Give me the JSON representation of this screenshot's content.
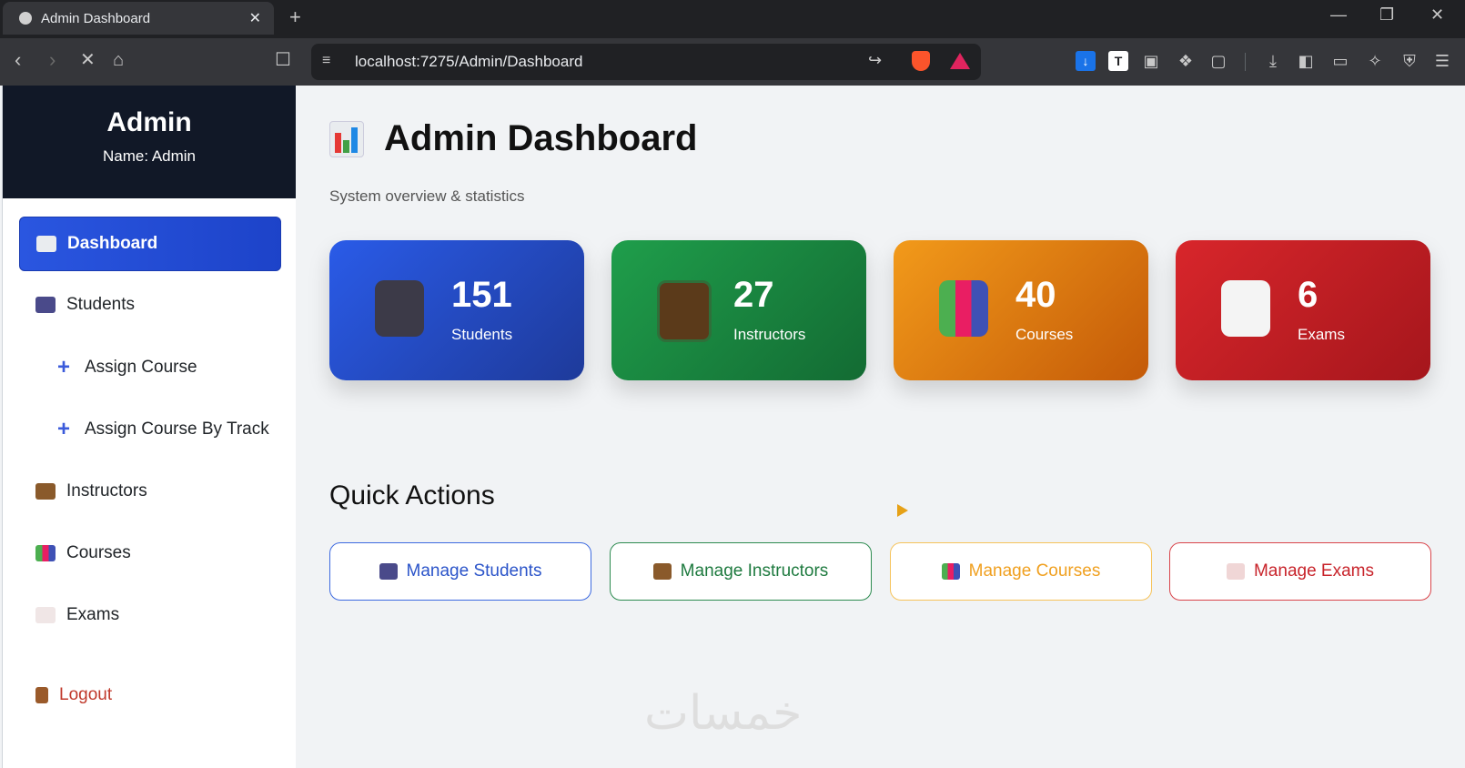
{
  "browser": {
    "tab_title": "Admin Dashboard",
    "tab_close": "✕",
    "new_tab": "+",
    "url": "localhost:7275/Admin/Dashboard"
  },
  "sidebar": {
    "title": "Admin",
    "name_line": "Name: Admin",
    "items": [
      {
        "label": "Dashboard",
        "icon": "chart-icon"
      },
      {
        "label": "Students",
        "icon": "users-icon"
      },
      {
        "label": "Assign Course",
        "icon": "plus-icon"
      },
      {
        "label": "Assign Course By Track",
        "icon": "plus-icon"
      },
      {
        "label": "Instructors",
        "icon": "teacher-icon"
      },
      {
        "label": "Courses",
        "icon": "books-icon"
      },
      {
        "label": "Exams",
        "icon": "memo-icon"
      },
      {
        "label": "Logout",
        "icon": "door-icon"
      }
    ]
  },
  "main": {
    "title": "Admin Dashboard",
    "subtitle": "System overview & statistics",
    "stats": [
      {
        "value": "151",
        "label": "Students"
      },
      {
        "value": "27",
        "label": "Instructors"
      },
      {
        "value": "40",
        "label": "Courses"
      },
      {
        "value": "6",
        "label": "Exams"
      }
    ],
    "quick_actions_title": "Quick Actions",
    "quick_actions": [
      {
        "label": "Manage Students"
      },
      {
        "label": "Manage Instructors"
      },
      {
        "label": "Manage Courses"
      },
      {
        "label": "Manage Exams"
      }
    ],
    "watermark": "خمسات"
  },
  "colors": {
    "primary": "#2a56e0",
    "success": "#1f9e4b",
    "warning": "#f29a1a",
    "danger": "#d8262b",
    "sidebar_header": "#111827"
  }
}
